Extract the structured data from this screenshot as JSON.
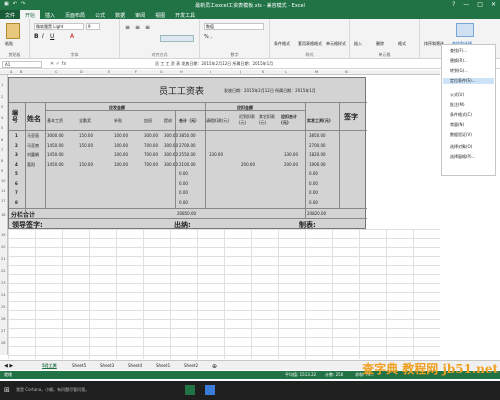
{
  "window": {
    "title": "最新员工excel工资表模板.xls - 兼容模式 - Excel",
    "controls": [
      "?",
      "—",
      "□",
      "✕"
    ]
  },
  "ribbon_tabs": [
    "文件",
    "开始",
    "插入",
    "页面布局",
    "公式",
    "数据",
    "审阅",
    "视图",
    "开发工具"
  ],
  "ribbon": {
    "font_name": "微软雅黑 Light",
    "font_size": "9",
    "number_format": "数值",
    "groups": [
      "剪贴板",
      "字体",
      "对齐方式",
      "数字",
      "样式",
      "单元格",
      "编辑"
    ],
    "buttons": [
      "粘贴",
      "条件格式",
      "套用表格格式",
      "单元格样式",
      "插入",
      "删除",
      "格式",
      "排序和筛选",
      "查找和选择"
    ]
  },
  "formula_bar": {
    "name_box": "A1",
    "formula_text": "员 工 工 资 表   发放日期：2015年2月12日  所属日期：2015年1月"
  },
  "column_headers": [
    "A",
    "B",
    "C",
    "D",
    "E",
    "F",
    "G",
    "H",
    "I",
    "J",
    "K",
    "L",
    "M",
    "N"
  ],
  "sheet": {
    "title": "员工工资表",
    "dates": "发放日期：2015年2月12日  所属日期：2015年1月",
    "header_no": "编号",
    "header_name": "姓名",
    "header_payable": "应发金额",
    "header_deduct": "应扣金额",
    "header_signature": "签字",
    "sub_headers": [
      "基本工资",
      "全勤奖",
      "补贴",
      "加班",
      "提成",
      "合计（元）",
      "请假扣款(元)",
      "迟到扣款(元)",
      "其它扣款(元)",
      "应扣合计(元)",
      "实发工资(元)"
    ],
    "rows": [
      {
        "no": "1",
        "name": "马亚丽",
        "cells": [
          "3000.00",
          "150.00",
          "100.00",
          "300.00",
          "300.00",
          "3850.00",
          "",
          "",
          "",
          "",
          "3850.00"
        ]
      },
      {
        "no": "2",
        "name": "马亚南",
        "cells": [
          "1450.00",
          "150.00",
          "100.00",
          "700.00",
          "300.00",
          "2700.00",
          "",
          "",
          "",
          "",
          "2700.00"
        ]
      },
      {
        "no": "3",
        "name": "刘露娟",
        "cells": [
          "1450.00",
          "",
          "100.00",
          "700.00",
          "300.00",
          "2550.00",
          "330.00",
          "",
          "",
          "330.00",
          "1820.00"
        ]
      },
      {
        "no": "4",
        "name": "葛阳",
        "cells": [
          "1450.00",
          "150.00",
          "100.00",
          "700.00",
          "300.00",
          "2100.00",
          "",
          "200.00",
          "",
          "200.00",
          "1900.00"
        ]
      },
      {
        "no": "5",
        "name": "",
        "cells": [
          "",
          "",
          "",
          "",
          "",
          "0.00",
          "",
          "",
          "",
          "",
          "0.00"
        ]
      },
      {
        "no": "6",
        "name": "",
        "cells": [
          "",
          "",
          "",
          "",
          "",
          "0.00",
          "",
          "",
          "",
          "",
          "0.00"
        ]
      },
      {
        "no": "7",
        "name": "",
        "cells": [
          "",
          "",
          "",
          "",
          "",
          "0.00",
          "",
          "",
          "",
          "",
          "0.00"
        ]
      },
      {
        "no": "8",
        "name": "",
        "cells": [
          "",
          "",
          "",
          "",
          "",
          "0.00",
          "",
          "",
          "",
          "",
          "0.00"
        ]
      }
    ],
    "subtotal_label": "分栏合计",
    "subtotal_pay": "20850.00",
    "subtotal_net": "20820.00",
    "leader_sign": "领导签字:",
    "cashier": "出纳:",
    "maker": "制表:"
  },
  "context_menu": {
    "items": [
      "查找(F)...",
      "替换(R)...",
      "转到(G)...",
      "定位条件(S)...",
      "公式(U)",
      "批注(M)",
      "条件格式(C)",
      "常量(N)",
      "数据验证(V)",
      "选择对象(O)",
      "选择窗格(P)..."
    ]
  },
  "sheet_tabs": [
    "5月工资",
    "Sheet5",
    "Sheet3",
    "Sheet4",
    "Sheet1",
    "Sheet2"
  ],
  "status": {
    "left": "就绪",
    "avg": "平均值: 1513.22",
    "count": "计数: 250",
    "sum": "求和: 74..."
  },
  "taskbar": {
    "search": "我是 Cortana，小娜。有问题尽管问我。"
  },
  "watermark": "查字典 教程网 jb51.net",
  "colors": {
    "excel_green": "#217346",
    "accent": "#1e6dc0"
  }
}
